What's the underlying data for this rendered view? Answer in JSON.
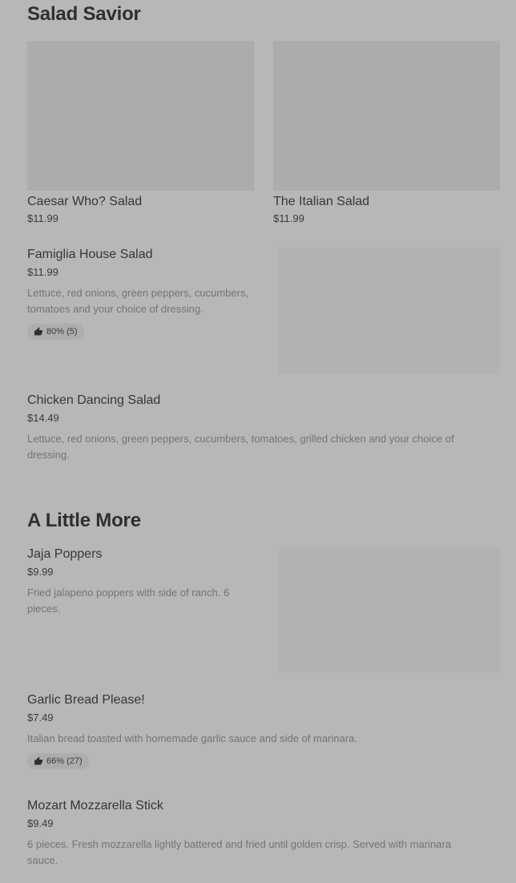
{
  "sections": [
    {
      "title": "Salad Savior"
    },
    {
      "title": "A Little More"
    }
  ],
  "featured": [
    {
      "name": "Caesar Who? Salad",
      "price": "$11.99"
    },
    {
      "name": "The Italian Salad",
      "price": "$11.99"
    }
  ],
  "items": [
    {
      "name": "Famiglia House Salad",
      "price": "$11.99",
      "description": "Lettuce, red onions, green peppers, cucumbers, tomatoes and your choice of dressing.",
      "rating": "80% (5)"
    },
    {
      "name": "Chicken Dancing Salad",
      "price": "$14.49",
      "description": "Lettuce, red onions, green peppers, cucumbers, tomatoes, grilled chicken and your choice of dressing."
    },
    {
      "name": "Jaja Poppers",
      "price": "$9.99",
      "description": "Fried jalapeno poppers with side of ranch. 6 pieces."
    },
    {
      "name": "Garlic Bread Please!",
      "price": "$7.49",
      "description": "Italian bread toasted with homemade garlic sauce and side of marinara.",
      "rating": "66% (27)"
    },
    {
      "name": "Mozart Mozzarella Stick",
      "price": "$9.49",
      "description": "6 pieces. Fresh mozzarella lightly battered and fried until golden crisp. Served with marinara sauce."
    }
  ],
  "icons": {
    "rating": "thumbs-up-icon"
  },
  "colors": {
    "background": "#b7b7b7",
    "placeholder": "#acacac",
    "text": "#363636",
    "muted": "#747474"
  }
}
